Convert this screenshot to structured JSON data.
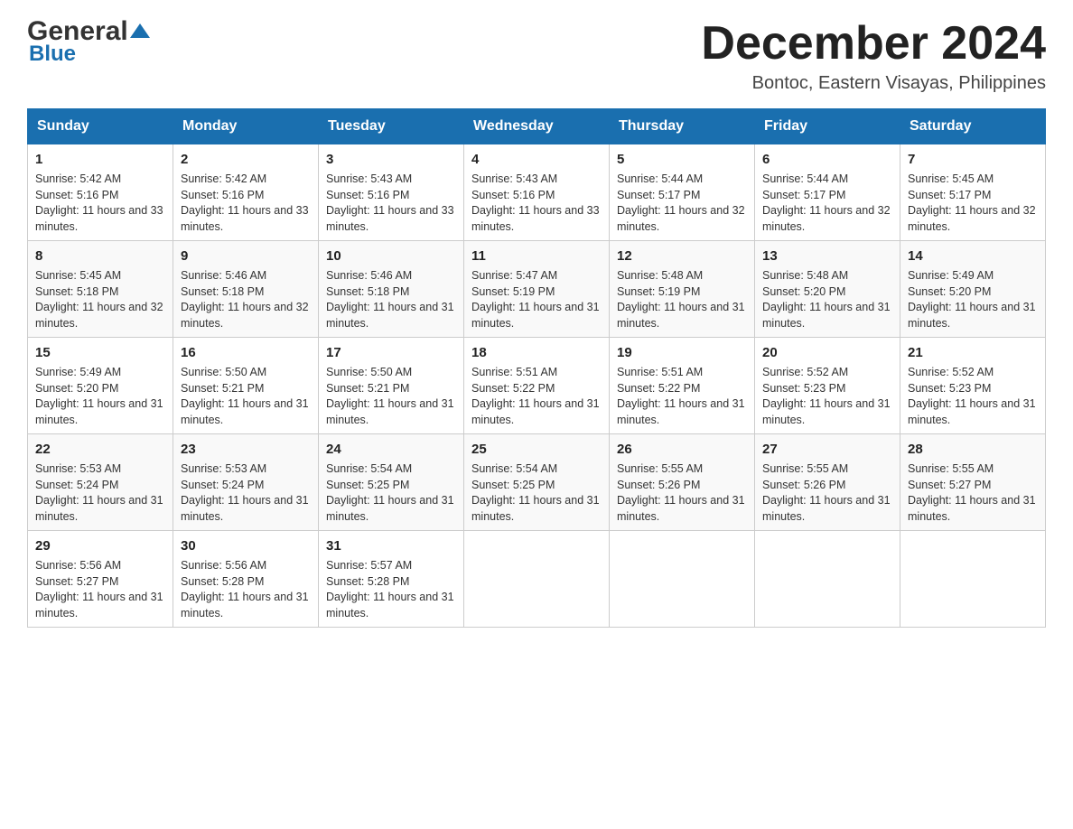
{
  "header": {
    "logo_general": "General",
    "logo_blue": "Blue",
    "month_year": "December 2024",
    "location": "Bontoc, Eastern Visayas, Philippines"
  },
  "weekdays": [
    "Sunday",
    "Monday",
    "Tuesday",
    "Wednesday",
    "Thursday",
    "Friday",
    "Saturday"
  ],
  "weeks": [
    [
      {
        "day": "1",
        "sunrise": "Sunrise: 5:42 AM",
        "sunset": "Sunset: 5:16 PM",
        "daylight": "Daylight: 11 hours and 33 minutes."
      },
      {
        "day": "2",
        "sunrise": "Sunrise: 5:42 AM",
        "sunset": "Sunset: 5:16 PM",
        "daylight": "Daylight: 11 hours and 33 minutes."
      },
      {
        "day": "3",
        "sunrise": "Sunrise: 5:43 AM",
        "sunset": "Sunset: 5:16 PM",
        "daylight": "Daylight: 11 hours and 33 minutes."
      },
      {
        "day": "4",
        "sunrise": "Sunrise: 5:43 AM",
        "sunset": "Sunset: 5:16 PM",
        "daylight": "Daylight: 11 hours and 33 minutes."
      },
      {
        "day": "5",
        "sunrise": "Sunrise: 5:44 AM",
        "sunset": "Sunset: 5:17 PM",
        "daylight": "Daylight: 11 hours and 32 minutes."
      },
      {
        "day": "6",
        "sunrise": "Sunrise: 5:44 AM",
        "sunset": "Sunset: 5:17 PM",
        "daylight": "Daylight: 11 hours and 32 minutes."
      },
      {
        "day": "7",
        "sunrise": "Sunrise: 5:45 AM",
        "sunset": "Sunset: 5:17 PM",
        "daylight": "Daylight: 11 hours and 32 minutes."
      }
    ],
    [
      {
        "day": "8",
        "sunrise": "Sunrise: 5:45 AM",
        "sunset": "Sunset: 5:18 PM",
        "daylight": "Daylight: 11 hours and 32 minutes."
      },
      {
        "day": "9",
        "sunrise": "Sunrise: 5:46 AM",
        "sunset": "Sunset: 5:18 PM",
        "daylight": "Daylight: 11 hours and 32 minutes."
      },
      {
        "day": "10",
        "sunrise": "Sunrise: 5:46 AM",
        "sunset": "Sunset: 5:18 PM",
        "daylight": "Daylight: 11 hours and 31 minutes."
      },
      {
        "day": "11",
        "sunrise": "Sunrise: 5:47 AM",
        "sunset": "Sunset: 5:19 PM",
        "daylight": "Daylight: 11 hours and 31 minutes."
      },
      {
        "day": "12",
        "sunrise": "Sunrise: 5:48 AM",
        "sunset": "Sunset: 5:19 PM",
        "daylight": "Daylight: 11 hours and 31 minutes."
      },
      {
        "day": "13",
        "sunrise": "Sunrise: 5:48 AM",
        "sunset": "Sunset: 5:20 PM",
        "daylight": "Daylight: 11 hours and 31 minutes."
      },
      {
        "day": "14",
        "sunrise": "Sunrise: 5:49 AM",
        "sunset": "Sunset: 5:20 PM",
        "daylight": "Daylight: 11 hours and 31 minutes."
      }
    ],
    [
      {
        "day": "15",
        "sunrise": "Sunrise: 5:49 AM",
        "sunset": "Sunset: 5:20 PM",
        "daylight": "Daylight: 11 hours and 31 minutes."
      },
      {
        "day": "16",
        "sunrise": "Sunrise: 5:50 AM",
        "sunset": "Sunset: 5:21 PM",
        "daylight": "Daylight: 11 hours and 31 minutes."
      },
      {
        "day": "17",
        "sunrise": "Sunrise: 5:50 AM",
        "sunset": "Sunset: 5:21 PM",
        "daylight": "Daylight: 11 hours and 31 minutes."
      },
      {
        "day": "18",
        "sunrise": "Sunrise: 5:51 AM",
        "sunset": "Sunset: 5:22 PM",
        "daylight": "Daylight: 11 hours and 31 minutes."
      },
      {
        "day": "19",
        "sunrise": "Sunrise: 5:51 AM",
        "sunset": "Sunset: 5:22 PM",
        "daylight": "Daylight: 11 hours and 31 minutes."
      },
      {
        "day": "20",
        "sunrise": "Sunrise: 5:52 AM",
        "sunset": "Sunset: 5:23 PM",
        "daylight": "Daylight: 11 hours and 31 minutes."
      },
      {
        "day": "21",
        "sunrise": "Sunrise: 5:52 AM",
        "sunset": "Sunset: 5:23 PM",
        "daylight": "Daylight: 11 hours and 31 minutes."
      }
    ],
    [
      {
        "day": "22",
        "sunrise": "Sunrise: 5:53 AM",
        "sunset": "Sunset: 5:24 PM",
        "daylight": "Daylight: 11 hours and 31 minutes."
      },
      {
        "day": "23",
        "sunrise": "Sunrise: 5:53 AM",
        "sunset": "Sunset: 5:24 PM",
        "daylight": "Daylight: 11 hours and 31 minutes."
      },
      {
        "day": "24",
        "sunrise": "Sunrise: 5:54 AM",
        "sunset": "Sunset: 5:25 PM",
        "daylight": "Daylight: 11 hours and 31 minutes."
      },
      {
        "day": "25",
        "sunrise": "Sunrise: 5:54 AM",
        "sunset": "Sunset: 5:25 PM",
        "daylight": "Daylight: 11 hours and 31 minutes."
      },
      {
        "day": "26",
        "sunrise": "Sunrise: 5:55 AM",
        "sunset": "Sunset: 5:26 PM",
        "daylight": "Daylight: 11 hours and 31 minutes."
      },
      {
        "day": "27",
        "sunrise": "Sunrise: 5:55 AM",
        "sunset": "Sunset: 5:26 PM",
        "daylight": "Daylight: 11 hours and 31 minutes."
      },
      {
        "day": "28",
        "sunrise": "Sunrise: 5:55 AM",
        "sunset": "Sunset: 5:27 PM",
        "daylight": "Daylight: 11 hours and 31 minutes."
      }
    ],
    [
      {
        "day": "29",
        "sunrise": "Sunrise: 5:56 AM",
        "sunset": "Sunset: 5:27 PM",
        "daylight": "Daylight: 11 hours and 31 minutes."
      },
      {
        "day": "30",
        "sunrise": "Sunrise: 5:56 AM",
        "sunset": "Sunset: 5:28 PM",
        "daylight": "Daylight: 11 hours and 31 minutes."
      },
      {
        "day": "31",
        "sunrise": "Sunrise: 5:57 AM",
        "sunset": "Sunset: 5:28 PM",
        "daylight": "Daylight: 11 hours and 31 minutes."
      },
      null,
      null,
      null,
      null
    ]
  ]
}
